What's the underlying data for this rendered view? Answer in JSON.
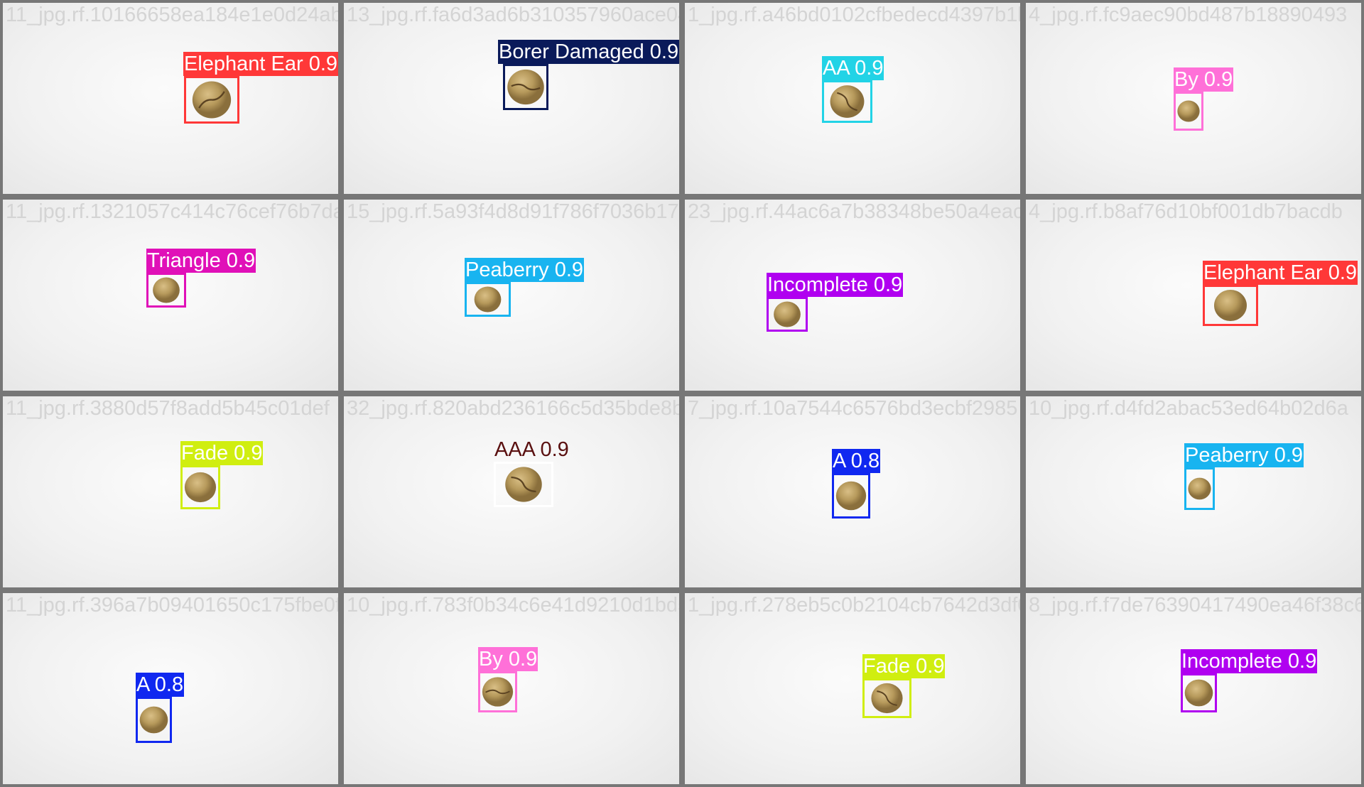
{
  "tiles": [
    {
      "filename": "11_jpg.rf.10166658ea184e1e0d24ab18a0eaf5",
      "label": "Elephant Ear 0.9",
      "color": "#ff3838"
    },
    {
      "filename": "13_jpg.rf.fa6d3ad6b310357960ace04cd0a9",
      "label": "Borer Damaged 0.9",
      "color": "#0a1a5a"
    },
    {
      "filename": "1_jpg.rf.a46bd0102cfbedecd4397b1b4",
      "label": "AA 0.9",
      "color": "#22d3e6"
    },
    {
      "filename": "4_jpg.rf.fc9aec90bd487b18890493",
      "label": "By 0.9",
      "color": "#ff70d8"
    },
    {
      "filename": "11_jpg.rf.1321057c414c76cef76b7da65",
      "label": "Triangle 0.9",
      "color": "#e010b8"
    },
    {
      "filename": "15_jpg.rf.5a93f4d8d91f786f7036b1703",
      "label": "Peaberry 0.9",
      "color": "#18b4f0"
    },
    {
      "filename": "23_jpg.rf.44ac6a7b38348be50a4eac",
      "label": "Incomplete 0.9",
      "color": "#b000f0"
    },
    {
      "filename": "4_jpg.rf.b8af76d10bf001db7bacdb",
      "label": "Elephant Ear 0.9",
      "color": "#ff3838"
    },
    {
      "filename": "11_jpg.rf.3880d57f8add5b45c01def",
      "label": "Fade 0.9",
      "color": "#d0ee10"
    },
    {
      "filename": "32_jpg.rf.820abd236166c5d35bde8bf907",
      "label": "AAA 0.9",
      "color": "#ffffff"
    },
    {
      "filename": "7_jpg.rf.10a7544c6576bd3ecbf2985",
      "label": "A 0.8",
      "color": "#1028f0"
    },
    {
      "filename": "10_jpg.rf.d4fd2abac53ed64b02d6a",
      "label": "Peaberry 0.9",
      "color": "#18b4f0"
    },
    {
      "filename": "11_jpg.rf.396a7b09401650c175fbe0f5",
      "label": "A 0.8",
      "color": "#1028f0"
    },
    {
      "filename": "10_jpg.rf.783f0b34c6e41d9210d1bd5f2c79",
      "label": "By 0.9",
      "color": "#ff70d8"
    },
    {
      "filename": "1_jpg.rf.278eb5c0b2104cb7642d3df08b",
      "label": "Fade 0.9",
      "color": "#d0ee10"
    },
    {
      "filename": "8_jpg.rf.f7de76390417490ea46f38c6",
      "label": "Incomplete 0.9",
      "color": "#b000f0"
    }
  ]
}
